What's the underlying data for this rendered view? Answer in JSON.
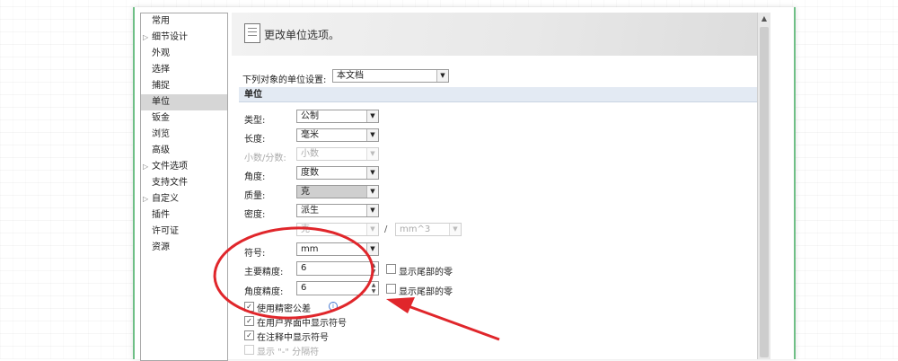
{
  "sidebar": {
    "items": [
      {
        "label": "常用",
        "expander": false
      },
      {
        "label": "细节设计",
        "expander": true
      },
      {
        "label": "外观",
        "expander": false
      },
      {
        "label": "选择",
        "expander": false
      },
      {
        "label": "捕捉",
        "expander": false
      },
      {
        "label": "单位",
        "expander": false,
        "selected": true
      },
      {
        "label": "钣金",
        "expander": false
      },
      {
        "label": "浏览",
        "expander": false
      },
      {
        "label": "高级",
        "expander": false
      },
      {
        "label": "文件选项",
        "expander": true
      },
      {
        "label": "支持文件",
        "expander": false
      },
      {
        "label": "自定义",
        "expander": true
      },
      {
        "label": "插件",
        "expander": false
      },
      {
        "label": "许可证",
        "expander": false
      },
      {
        "label": "资源",
        "expander": false
      }
    ]
  },
  "header": {
    "title": "更改单位选项。",
    "icon": "document-icon"
  },
  "scope": {
    "label": "下列对象的单位设置:",
    "value": "本文档"
  },
  "section": {
    "title": "单位"
  },
  "fields": {
    "type": {
      "label": "类型:",
      "value": "公制"
    },
    "length": {
      "label": "长度:",
      "value": "毫米"
    },
    "decimal": {
      "label": "小数/分数:",
      "value": "小数"
    },
    "angle": {
      "label": "角度:",
      "value": "度数"
    },
    "mass": {
      "label": "质量:",
      "value": "克"
    },
    "density": {
      "label": "密度:",
      "value": "派生"
    },
    "density_num": {
      "value": "克"
    },
    "density_sep": "/",
    "density_den": {
      "value": "mm^3"
    },
    "symbol": {
      "label": "符号:",
      "value": "mm"
    },
    "primary_precision": {
      "label": "主要精度:",
      "value": "6",
      "checkbox_label": "显示尾部的零"
    },
    "angular_precision": {
      "label": "角度精度:",
      "value": "6",
      "checkbox_label": "显示尾部的零"
    }
  },
  "checks": [
    {
      "label": "使用精密公差",
      "checked": true
    },
    {
      "label": "在用户界面中显示符号",
      "checked": true
    },
    {
      "label": "在注释中显示符号",
      "checked": true
    },
    {
      "label": "显示 \"-\" 分隔符",
      "checked": false,
      "disabled": true
    }
  ],
  "colors": {
    "annotation_red": "#e0262b",
    "selected_bg": "#d6d6d6",
    "section_bg": "#e3eaf3"
  }
}
